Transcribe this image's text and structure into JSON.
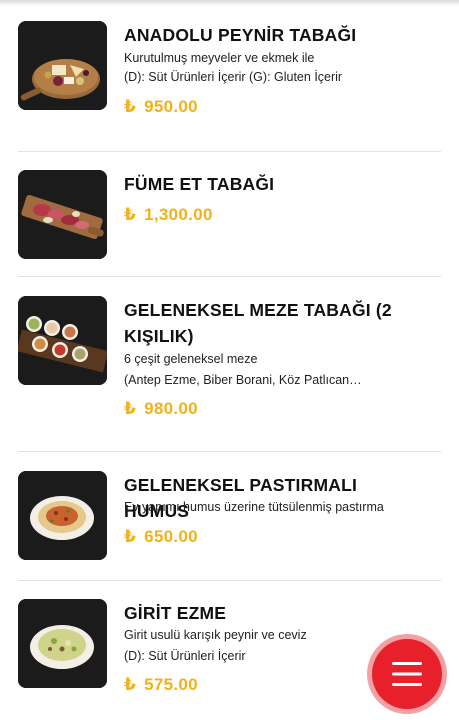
{
  "currency_symbol": "₺",
  "items": [
    {
      "title": "ANADOLU PEYNİR TABAĞI",
      "desc1": "Kurutulmuş meyveler ve ekmek ile",
      "desc2": "(D): Süt Ürünleri İçerir (G): Gluten İçerir",
      "price": "950.00",
      "image_icon": "cheese-platter-photo"
    },
    {
      "title": "FÜME ET TABAĞI",
      "price": "1,300.00",
      "image_icon": "smoked-meat-board-photo"
    },
    {
      "title": "GELENEKSEL MEZE TABAĞI (2 KIŞILIK)",
      "desc1": "6 çeşit geleneksel meze",
      "desc2": "(Antep Ezme, Biber Borani, Köz Patlıcan…",
      "price": "980.00",
      "image_icon": "meze-plates-photo"
    },
    {
      "title": "GELENEKSEL PASTIRMALI HUMUS",
      "desc1": "Ev yapımı humus üzerine tütsülenmiş pastırma",
      "price": "650.00",
      "image_icon": "hummus-bowl-photo"
    },
    {
      "title": "GİRİT EZME",
      "desc1": "Girit usulü karışık peynir ve ceviz",
      "desc2": "(D): Süt Ürünleri İçerir",
      "price": "575.00",
      "image_icon": "girit-ezme-bowl-photo"
    }
  ],
  "fab": {
    "icon": "hamburger-menu-icon",
    "color": "#e8202c"
  },
  "colors": {
    "price": "#f2b11c",
    "divider": "#e2e2e2"
  }
}
